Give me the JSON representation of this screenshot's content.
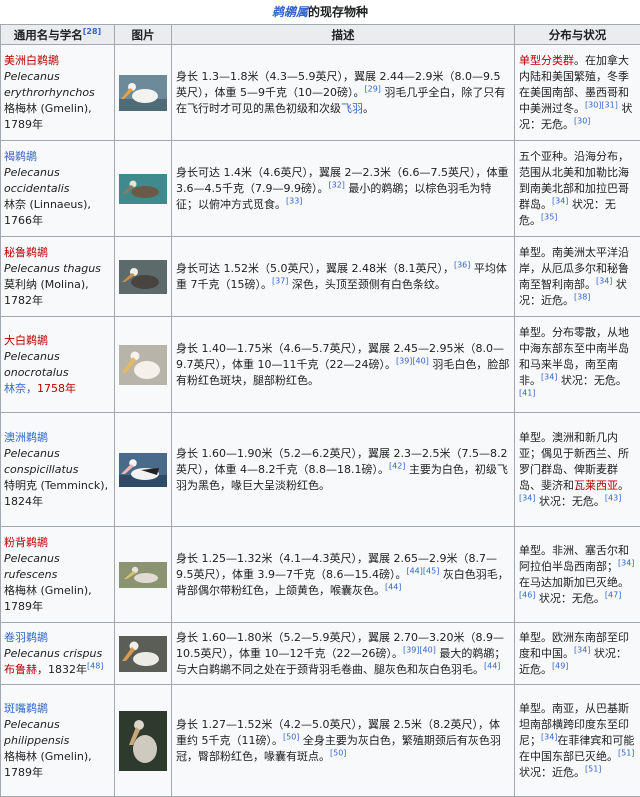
{
  "caption": {
    "genus": "鹈鹕属",
    "suffix": "的现存物种"
  },
  "headers": {
    "name": "通用名与学名",
    "name_ref": "[28]",
    "image": "图片",
    "desc": "描述",
    "status": "分布与状况"
  },
  "colors": {
    "link": "#3366cc",
    "redlink": "#ba0000",
    "header_bg": "#eaecf0",
    "cell_bg": "#f8f9fa",
    "border": "#a2a9b1"
  },
  "rows": [
    {
      "common": "美洲白鹈鹕",
      "scientific": "Pelecanus erythrorhynchos",
      "authority": "格梅林 (Gmelin),",
      "year": "1789年",
      "desc": "身长 1.3—1.8米（4.3—5.9英尺），翼展 2.44—2.9米（8.0—9.5英尺），体重 5—9千克（10—20磅）。",
      "desc_ref": "[29]",
      "desc2": "羽毛几乎全白，除了只有在飞行时才可见的黑色初级和次级",
      "desc_link": "飞羽",
      "desc3": "。",
      "status_link": "单型分类群",
      "status": "。在加拿大内陆和美国繁殖，冬季在美国南部、墨西哥和中美洲过冬。",
      "status_ref": "[30][31]",
      "status2": "状况：无危。",
      "status_ref2": "[30]"
    },
    {
      "common": "褐鹈鹕",
      "scientific": "Pelecanus occidentalis",
      "authority": "林奈 (Linnaeus),",
      "year": "1766年",
      "desc": "身长可达 1.4米（4.6英尺），翼展 2—2.3米（6.6—7.5英尺），体重 3.6—4.5千克（7.9—9.9磅）。",
      "desc_ref": "[32]",
      "desc2": "最小的鹈鹕；以棕色羽毛为特征；以俯冲方式觅食。",
      "desc_ref2": "[33]",
      "status": "五个亚种。沿海分布，范围从北美和加勒比海到南美北部和加拉巴哥群岛。",
      "status_ref": "[34]",
      "status2": "状况：无危。",
      "status_ref2": "[35]"
    },
    {
      "common": "秘鲁鹈鹕",
      "scientific": "Pelecanus thagus",
      "authority": "莫利纳 (Molina),",
      "year": "1782年",
      "desc": "身长可达 1.52米（5.0英尺），翼展 2.48米（8.1英尺），",
      "desc_ref": "[36]",
      "desc2": "平均体重 7千克（15磅）。",
      "desc_ref2": "[37]",
      "desc3": "深色，头顶至颈侧有白色条纹。",
      "status": "单型。南美洲太平洋沿岸，从厄瓜多尔和秘鲁南至智利南部。",
      "status_ref": "[34]",
      "status2": "状况：近危。",
      "status_ref2": "[38]"
    },
    {
      "common": "大白鹈鹕",
      "scientific": "Pelecanus onocrotalus",
      "authority": "林奈，",
      "year": "1758年",
      "desc": "身长 1.40—1.75米（4.6—5.7英尺），翼展 2.45—2.95米（8.0—9.7英尺），体重 10—11千克（22—24磅）。",
      "desc_ref": "[39][40]",
      "desc2": "羽毛白色，脸部有粉红色斑块，腿部粉红色。",
      "status": "单型。分布零散，从地中海东部东至中南半岛和马来半岛，南至南非。",
      "status_ref": "[34]",
      "status2": "状况：无危。",
      "status_ref2": "[41]"
    },
    {
      "common": "澳洲鹈鹕",
      "scientific": "Pelecanus conspicillatus",
      "authority": "特明克 (Temminck),",
      "year": "1824年",
      "desc": "身长 1.60—1.90米（5.2—6.2英尺），翼展 2.3—2.5米（7.5—8.2英尺），体重 4—8.2千克（8.8—18.1磅）。",
      "desc_ref": "[42]",
      "desc2": "主要为白色，初级飞羽为黑色，喙巨大呈淡粉红色。",
      "status": "单型。澳洲和新几内亚；偶见于新西兰、所罗门群岛、俾斯麦群岛、斐济和",
      "status_link": "瓦莱西亚",
      "status_tail": "。",
      "status_ref": "[34]",
      "status2": "状况：无危。",
      "status_ref2": "[43]"
    },
    {
      "common": "粉背鹈鹕",
      "scientific": "Pelecanus rufescens",
      "authority": "格梅林 (Gmelin),",
      "year": "1789年",
      "desc": "身长 1.25—1.32米（4.1—4.3英尺），翼展 2.65—2.9米（8.7—9.5英尺），体重 3.9—7千克（8.6—15.4磅）。",
      "desc_ref": "[44]",
      "desc_ref_b": "[45]",
      "desc2": "灰白色羽毛，背部偶尔带粉红色，上颌黄色，喉囊灰色。",
      "desc_ref2": "[44]",
      "status": "单型。非洲、塞舌尔和阿拉伯半岛西南部；",
      "status_ref": "[34]",
      "status_mid": "在马达加斯加已灭绝。",
      "status_ref_m": "[46]",
      "status2": "状况：无危。",
      "status_ref2": "[47]"
    },
    {
      "common": "卷羽鹈鹕",
      "scientific": "Pelecanus crispus",
      "authority": "布鲁赫，",
      "authority_tail": "1832年",
      "year_ref": "[48]",
      "desc": "身长 1.60—1.80米（5.2—5.9英尺），翼展 2.70—3.20米（8.9—10.5英尺），体重 10—12千克（22—26磅）。",
      "desc_ref": "[39][40]",
      "desc2": "最大的鹈鹕；与大白鹈鹕不同之处在于颈背羽毛卷曲、腿灰色和灰白色羽毛。",
      "desc_ref2": "[44]",
      "status": "单型。欧洲东南部至印度和中国。",
      "status_ref": "[34]",
      "status2": "状况：近危。",
      "status_ref2": "[49]"
    },
    {
      "common": "斑嘴鹈鹕",
      "scientific": "Pelecanus philippensis",
      "authority": "格梅林 (Gmelin),",
      "year": "1789年",
      "desc": "身长 1.27—1.52米（4.2—5.0英尺），翼展 2.5米（8.2英尺），体重约 5千克（11磅）。",
      "desc_ref": "[50]",
      "desc2": "全身主要为灰白色，繁殖期颈后有灰色羽冠，臀部粉红色，喙囊有斑点。",
      "desc_ref2": "[50]",
      "status": "单型。南亚，从巴基斯坦南部横跨印度东至印尼；",
      "status_ref": "[34]",
      "status_mid": "在菲律宾和可能在中国东部已灭绝。",
      "status_ref_m": "[51]",
      "status2": "状况：近危。",
      "status_ref2": "[51]"
    }
  ]
}
